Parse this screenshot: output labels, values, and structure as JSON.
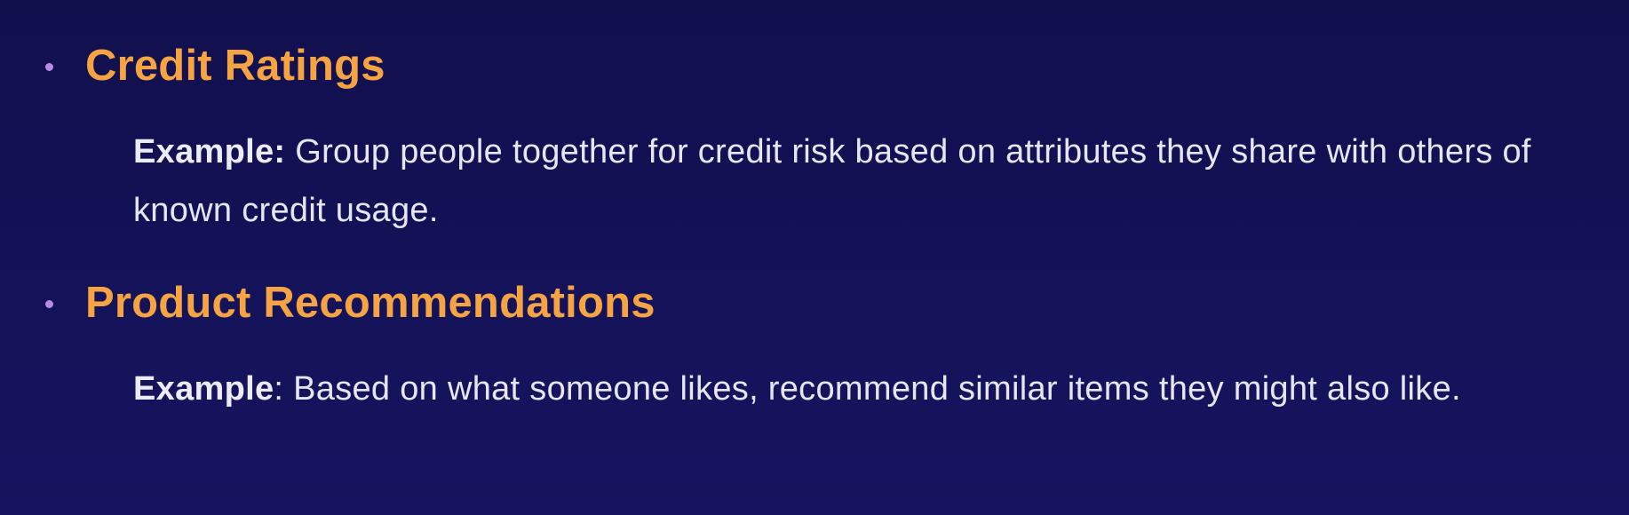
{
  "items": [
    {
      "heading": "Credit Ratings",
      "example_label": "Example:",
      "example_text": " Group people together for credit risk based on attributes they share with others of known credit usage."
    },
    {
      "heading": "Product Recommendations",
      "example_label": "Example",
      "example_text": ": Based on what someone likes, recommend similar items they might also like."
    }
  ],
  "colors": {
    "background": "#141258",
    "heading": "#f5a343",
    "bullet": "#b88ae6",
    "body_text": "#e6e6f2"
  }
}
